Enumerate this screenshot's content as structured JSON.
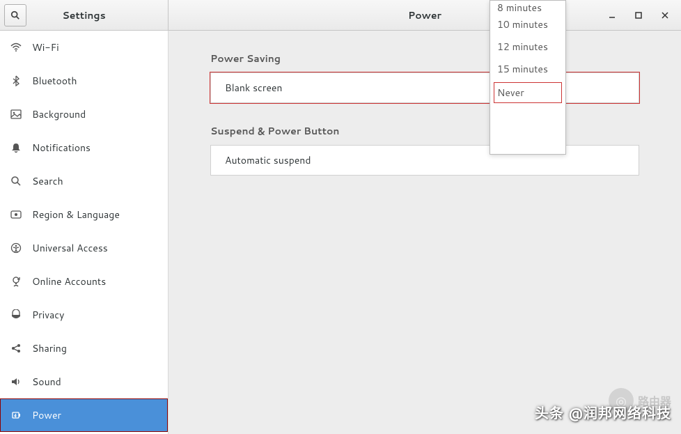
{
  "header": {
    "left_title": "Settings",
    "right_title": "Power"
  },
  "sidebar": {
    "items": [
      {
        "icon": "wifi",
        "label": "Wi-Fi"
      },
      {
        "icon": "bluetooth",
        "label": "Bluetooth"
      },
      {
        "icon": "background",
        "label": "Background"
      },
      {
        "icon": "notifications",
        "label": "Notifications"
      },
      {
        "icon": "search",
        "label": "Search"
      },
      {
        "icon": "region",
        "label": "Region & Language"
      },
      {
        "icon": "universal",
        "label": "Universal Access"
      },
      {
        "icon": "online",
        "label": "Online Accounts"
      },
      {
        "icon": "privacy",
        "label": "Privacy"
      },
      {
        "icon": "sharing",
        "label": "Sharing"
      },
      {
        "icon": "sound",
        "label": "Sound"
      },
      {
        "icon": "power",
        "label": "Power"
      }
    ]
  },
  "main": {
    "section1_title": "Power Saving",
    "row1_label": "Blank screen",
    "section2_title": "Suspend & Power Button",
    "row2_label": "Automatic suspend"
  },
  "dropdown": {
    "options": [
      "8 minutes",
      "10 minutes",
      "12 minutes",
      "15 minutes",
      "Never"
    ]
  },
  "watermark": {
    "text": "头条 @润邦网络科技",
    "badge_text": "路由器"
  }
}
